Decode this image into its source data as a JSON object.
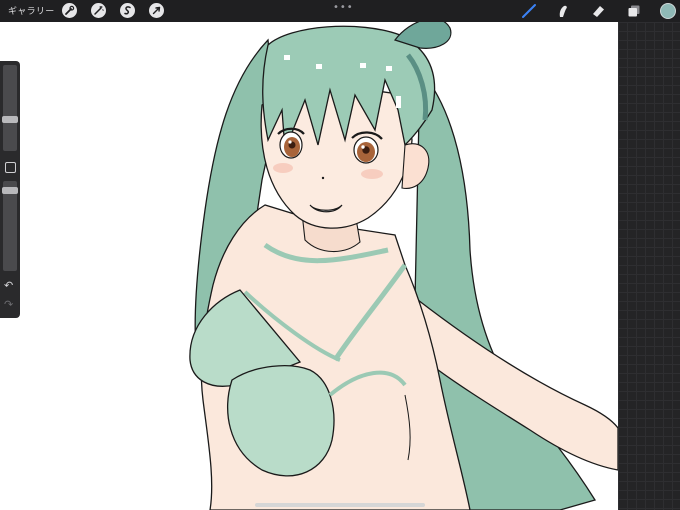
{
  "topbar": {
    "gallery_label": "ギャラリー",
    "left_tools": [
      {
        "name": "actions",
        "icon": "wrench-icon"
      },
      {
        "name": "adjustments",
        "icon": "magic-wand-icon"
      },
      {
        "name": "selection",
        "icon": "selection-s-icon"
      },
      {
        "name": "transform",
        "icon": "arrow-cursor-icon"
      }
    ],
    "center_handle": "•••",
    "right_tools": [
      {
        "name": "brush",
        "icon": "brush-icon",
        "active": true,
        "color": "#3b82f6"
      },
      {
        "name": "smudge",
        "icon": "smudge-icon"
      },
      {
        "name": "eraser",
        "icon": "eraser-icon"
      },
      {
        "name": "layers",
        "icon": "layers-icon"
      }
    ],
    "current_color": "#8fb9b6"
  },
  "sidebar": {
    "brush_size_level": 0.22,
    "opacity_level": 0.07,
    "modify_icon": "square-icon",
    "undo_icon": "undo-icon",
    "redo_icon": "redo-icon"
  },
  "canvas": {
    "artwork": "illustration"
  },
  "colors": {
    "ui_dark": "#1f1f21",
    "hair": "#8fc1ac",
    "skin": "#fbe8dc",
    "swimsuit": "#b9dcc9",
    "line": "#1a1a1a"
  }
}
